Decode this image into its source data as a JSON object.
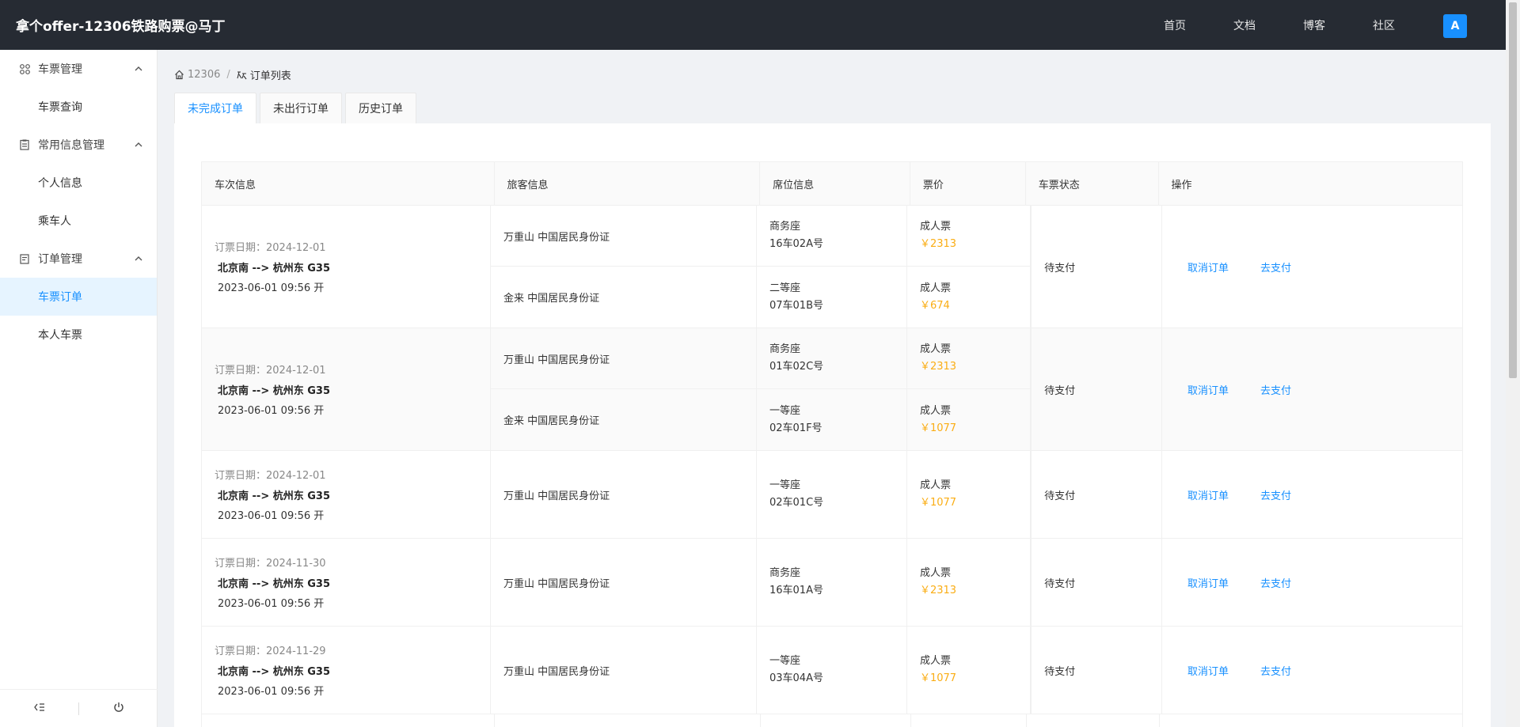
{
  "header": {
    "brand": "拿个offer-12306铁路购票@马丁",
    "nav": [
      "首页",
      "文档",
      "博客",
      "社区"
    ],
    "avatar": "A"
  },
  "sidebar": {
    "groups": [
      {
        "label": "车票管理",
        "icon": "apps-icon",
        "items": [
          "车票查询"
        ]
      },
      {
        "label": "常用信息管理",
        "icon": "document-icon",
        "items": [
          "个人信息",
          "乘车人"
        ]
      },
      {
        "label": "订单管理",
        "icon": "order-icon",
        "items": [
          "车票订单",
          "本人车票"
        ]
      }
    ],
    "active_item": "车票订单"
  },
  "breadcrumb": {
    "home": "12306",
    "current": "订单列表"
  },
  "tabs": [
    "未完成订单",
    "未出行订单",
    "历史订单"
  ],
  "table": {
    "headers": [
      "车次信息",
      "旅客信息",
      "席位信息",
      "票价",
      "车票状态",
      "操作"
    ],
    "orders": [
      {
        "order_date": "订票日期：2024-12-01",
        "route": "北京南 --> 杭州东 G35",
        "depart": "2023-06-01 09:56 开",
        "status": "待支付",
        "passengers": [
          {
            "name": "万重山 中国居民身份证",
            "seat_type": "商务座",
            "seat_no": "16车02A号",
            "ticket_type": "成人票",
            "price": "￥2313"
          },
          {
            "name": "金来 中国居民身份证",
            "seat_type": "二等座",
            "seat_no": "07车01B号",
            "ticket_type": "成人票",
            "price": "￥674"
          }
        ]
      },
      {
        "order_date": "订票日期：2024-12-01",
        "route": "北京南 --> 杭州东 G35",
        "depart": "2023-06-01 09:56 开",
        "status": "待支付",
        "passengers": [
          {
            "name": "万重山 中国居民身份证",
            "seat_type": "商务座",
            "seat_no": "01车02C号",
            "ticket_type": "成人票",
            "price": "￥2313"
          },
          {
            "name": "金来 中国居民身份证",
            "seat_type": "一等座",
            "seat_no": "02车01F号",
            "ticket_type": "成人票",
            "price": "￥1077"
          }
        ]
      },
      {
        "order_date": "订票日期：2024-12-01",
        "route": "北京南 --> 杭州东 G35",
        "depart": "2023-06-01 09:56 开",
        "status": "待支付",
        "passengers": [
          {
            "name": "万重山 中国居民身份证",
            "seat_type": "一等座",
            "seat_no": "02车01C号",
            "ticket_type": "成人票",
            "price": "￥1077"
          }
        ]
      },
      {
        "order_date": "订票日期：2024-11-30",
        "route": "北京南 --> 杭州东 G35",
        "depart": "2023-06-01 09:56 开",
        "status": "待支付",
        "passengers": [
          {
            "name": "万重山 中国居民身份证",
            "seat_type": "商务座",
            "seat_no": "16车01A号",
            "ticket_type": "成人票",
            "price": "￥2313"
          }
        ]
      },
      {
        "order_date": "订票日期：2024-11-29",
        "route": "北京南 --> 杭州东 G35",
        "depart": "2023-06-01 09:56 开",
        "status": "待支付",
        "passengers": [
          {
            "name": "万重山 中国居民身份证",
            "seat_type": "一等座",
            "seat_no": "03车04A号",
            "ticket_type": "成人票",
            "price": "￥1077"
          }
        ]
      }
    ],
    "actions": {
      "cancel": "取消订单",
      "pay": "去支付"
    }
  },
  "colors": {
    "accent": "#1890ff",
    "price": "#faad14",
    "header_bg": "#262b33"
  }
}
